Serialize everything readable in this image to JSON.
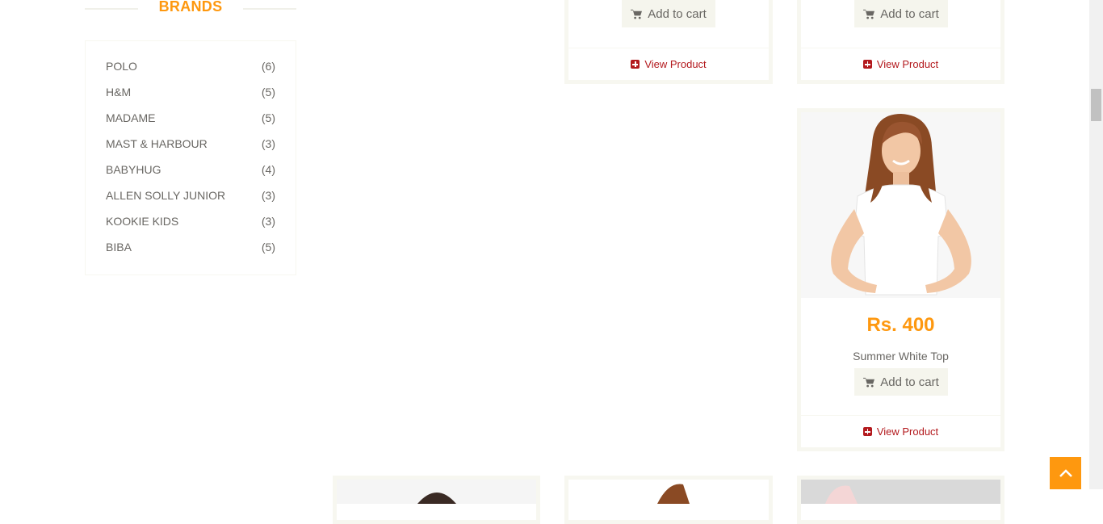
{
  "sidebar": {
    "brands_title": "BRANDS",
    "brands": [
      {
        "name": "POLO",
        "count": "(6)"
      },
      {
        "name": "H&M",
        "count": "(5)"
      },
      {
        "name": "MADAME",
        "count": "(5)"
      },
      {
        "name": "MAST & HARBOUR",
        "count": "(3)"
      },
      {
        "name": "BABYHUG",
        "count": "(4)"
      },
      {
        "name": "ALLEN SOLLY JUNIOR",
        "count": "(3)"
      },
      {
        "name": "KOOKIE KIDS",
        "count": "(3)"
      },
      {
        "name": "BIBA",
        "count": "(5)"
      }
    ]
  },
  "products": {
    "top_left": {
      "add_to_cart": "Add to cart",
      "view_product": "View Product"
    },
    "top_right": {
      "add_to_cart": "Add to cart",
      "view_product": "View Product"
    },
    "featured": {
      "price": "Rs. 400",
      "name": "Summer White Top",
      "add_to_cart": "Add to cart",
      "view_product": "View Product"
    }
  },
  "colors": {
    "accent": "#fe980f",
    "link_red": "#b3191d",
    "text": "#696763"
  },
  "icons": {
    "cart": "shopping-cart-icon",
    "view": "plus-square-icon",
    "scroll_up": "chevron-up-icon"
  }
}
